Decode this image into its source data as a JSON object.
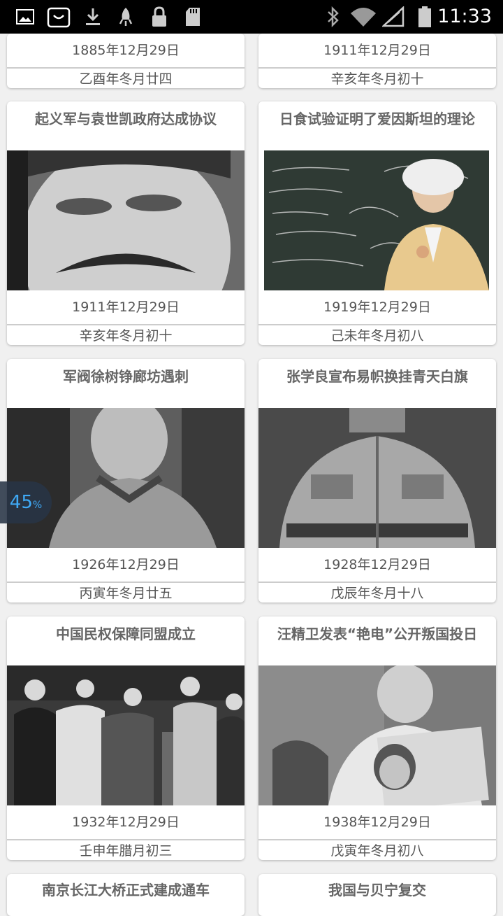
{
  "status_bar": {
    "time": "11:33",
    "icons": [
      "image-icon",
      "store-bag-icon",
      "download-icon",
      "rocket-icon",
      "lock-icon",
      "sd-card-icon",
      "bluetooth-icon",
      "wifi-icon",
      "signal-icon",
      "battery-icon"
    ]
  },
  "floating_badge": {
    "value": "45",
    "unit": "%"
  },
  "cards": [
    {
      "date": "1885年12月29日",
      "lunar": "乙酉年冬月廿四"
    },
    {
      "date": "1911年12月29日",
      "lunar": "辛亥年冬月初十"
    },
    {
      "title": "起义军与袁世凯政府达成协议",
      "date": "1911年12月29日",
      "lunar": "辛亥年冬月初十"
    },
    {
      "title": "日食试验证明了爱因斯坦的理论",
      "date": "1919年12月29日",
      "lunar": "己未年冬月初八"
    },
    {
      "title": "军阀徐树铮廊坊遇刺",
      "date": "1926年12月29日",
      "lunar": "丙寅年冬月廿五"
    },
    {
      "title": "张学良宣布易帜换挂青天白旗",
      "date": "1928年12月29日",
      "lunar": "戊辰年冬月十八"
    },
    {
      "title": "中国民权保障同盟成立",
      "date": "1932年12月29日",
      "lunar": "壬申年腊月初三"
    },
    {
      "title": "汪精卫发表“艳电”公开叛国投日",
      "date": "1938年12月29日",
      "lunar": "戊寅年冬月初八"
    },
    {
      "title": "南京长江大桥正式建成通车"
    },
    {
      "title": "我国与贝宁复交"
    }
  ]
}
